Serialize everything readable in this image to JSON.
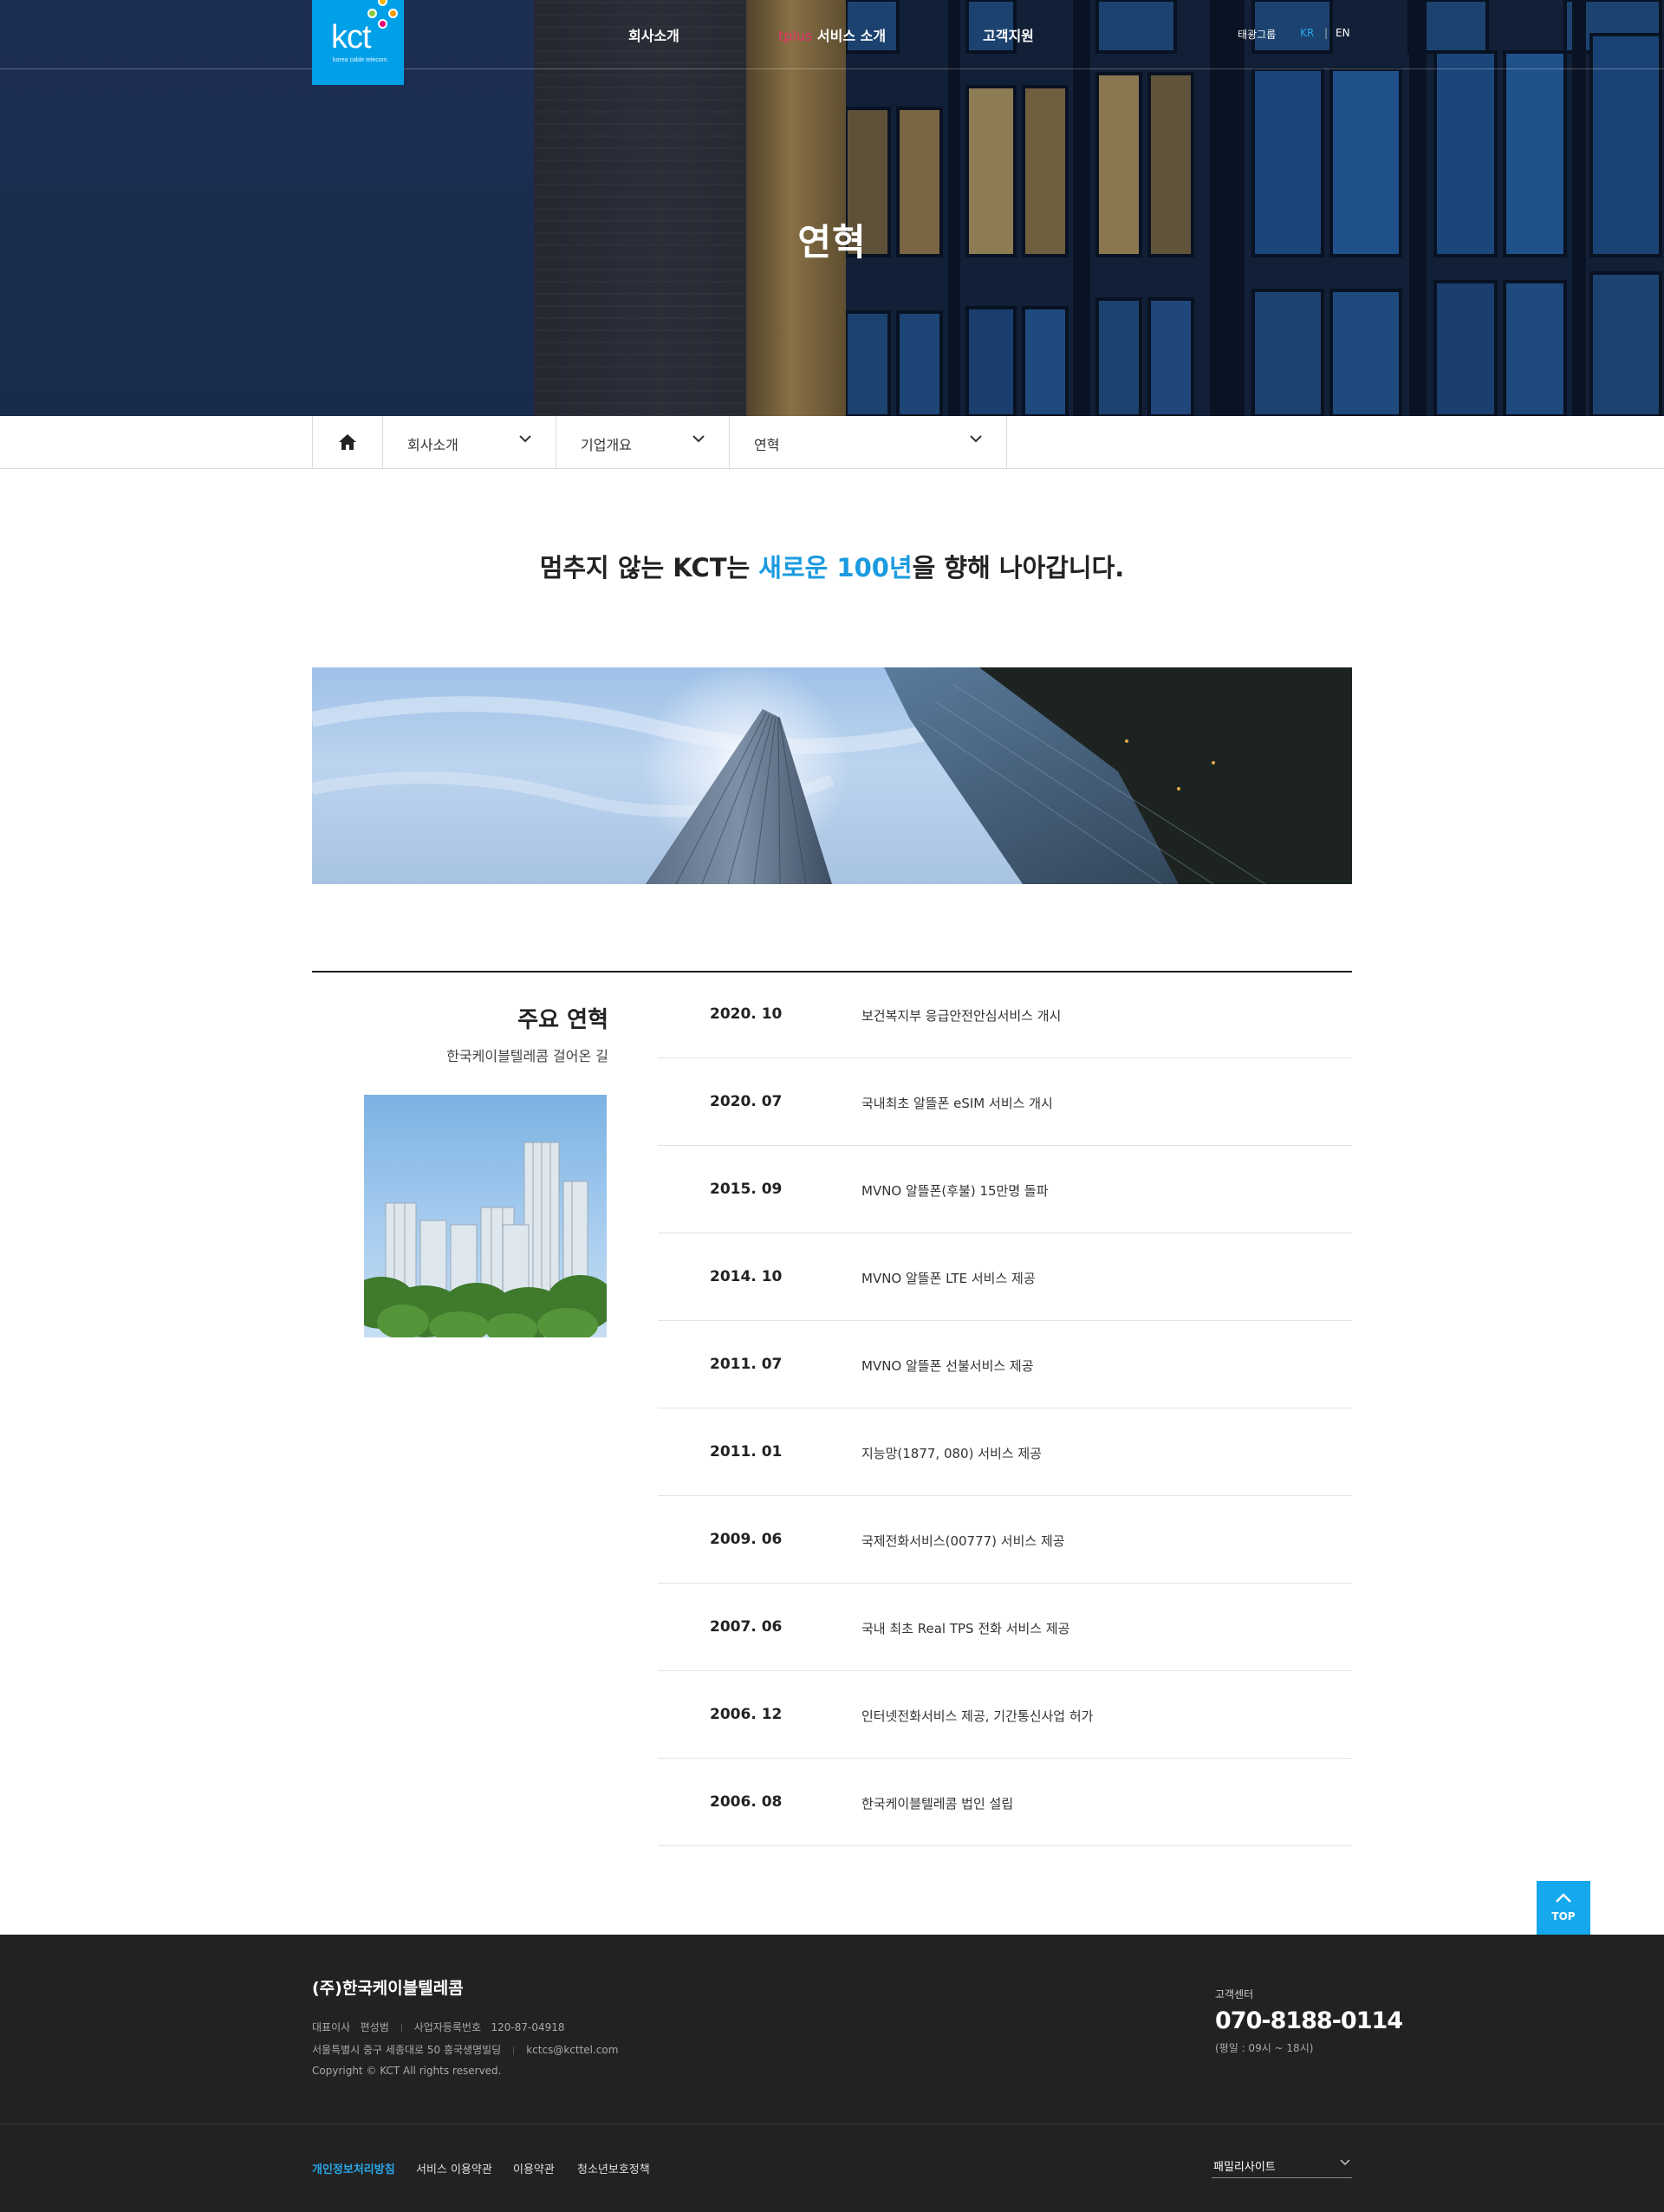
{
  "header": {
    "logo_text": "kct",
    "logo_sub": "korea cable telecom",
    "nav": [
      {
        "label": "회사소개"
      },
      {
        "accent": "tplus",
        "label": " 서비스 소개"
      },
      {
        "label": "고객지원"
      }
    ],
    "util": {
      "group": "태광그룹",
      "kr": "KR",
      "sep": "|",
      "en": "EN"
    }
  },
  "hero": {
    "title": "연혁"
  },
  "location": {
    "home_icon": "home-icon",
    "depth1": "회사소개",
    "depth2": "기업개요",
    "depth3": "연혁"
  },
  "slogan": {
    "pre": "멈추지 않는 KCT는 ",
    "highlight": "새로운 100년",
    "post": "을 향해 나아갑니다."
  },
  "history": {
    "title": "주요 연혁",
    "subtitle": "한국케이블텔레콤 걸어온 길",
    "items": [
      {
        "date": "2020. 10",
        "text": "보건복지부 응급안전안심서비스 개시"
      },
      {
        "date": "2020. 07",
        "text": "국내최초 알뜰폰 eSIM 서비스 개시"
      },
      {
        "date": "2015. 09",
        "text": "MVNO 알뜰폰(후불) 15만명 돌파"
      },
      {
        "date": "2014. 10",
        "text": "MVNO 알뜰폰 LTE 서비스 제공"
      },
      {
        "date": "2011. 07",
        "text": "MVNO 알뜰폰 선불서비스 제공"
      },
      {
        "date": "2011. 01",
        "text": "지능망(1877, 080) 서비스 제공"
      },
      {
        "date": "2009. 06",
        "text": "국제전화서비스(00777) 서비스 제공"
      },
      {
        "date": "2007. 06",
        "text": "국내 최초 Real TPS 전화 서비스 제공"
      },
      {
        "date": "2006. 12",
        "text": "인터넷전화서비스 제공, 기간통신사업 허가"
      },
      {
        "date": "2006. 08",
        "text": "한국케이블텔레콤 법인 설립"
      }
    ]
  },
  "top_button": {
    "label": "TOP",
    "icon": "arrow-up-icon"
  },
  "footer": {
    "company": "(주)한국케이블텔레콤",
    "ceo_label": "대표이사",
    "ceo": "편성범",
    "biz_label": "사업자등록번호",
    "biz_no": "120-87-04918",
    "address": "서울특별시 중구 세종대로 50 흥국생명빌딩",
    "email": "kctcs@kcttel.com",
    "copyright": "Copyright © KCT All rights reserved.",
    "cs_label": "고객센터",
    "cs_phone": "070-8188-0114",
    "cs_hours": "(평일 : 09시 ~ 18시)",
    "links": [
      "개인정보처리방침",
      "서비스 이용약관",
      "이용약관",
      "청소년보호정책"
    ],
    "family_site": "패밀리사이트"
  },
  "colors": {
    "brand": "#00a0e9",
    "accent": "#e8336d",
    "highlight": "#1a9be0",
    "footer_bg": "#222222"
  }
}
